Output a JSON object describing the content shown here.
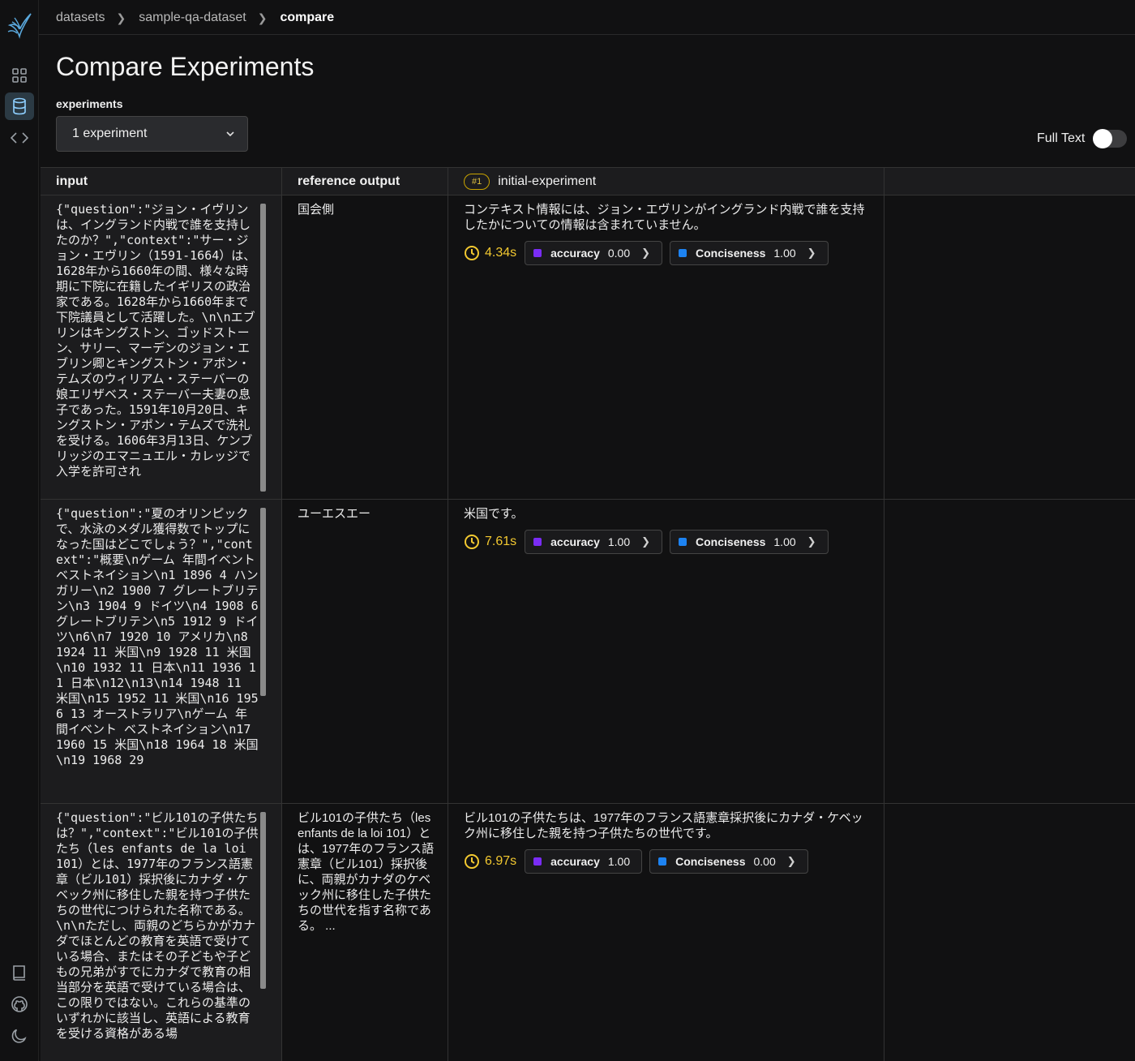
{
  "breadcrumb": {
    "items": [
      "datasets",
      "sample-qa-dataset"
    ],
    "current": "compare"
  },
  "page": {
    "title": "Compare Experiments"
  },
  "experiments": {
    "label": "experiments",
    "selected": "1 experiment"
  },
  "full_text": {
    "label": "Full Text",
    "enabled": false
  },
  "columns": {
    "input": "input",
    "reference": "reference output",
    "experiment_badge": "#1",
    "experiment_name": "initial-experiment"
  },
  "colors": {
    "accuracy": "#7a2cf5",
    "conciseness": "#1d83f2",
    "latency": "#f2c830"
  },
  "rows": [
    {
      "input": "{\"question\":\"ジョン・イヴリンは、イングランド内戦で誰を支持したのか？\",\"context\":\"サー・ジョン・エヴリン（1591-1664）は、1628年から1660年の間、様々な時期に下院に在籍したイギリスの政治家である。1628年から1660年まで下院議員として活躍した。\\n\\nエブリンはキングストン、ゴッドストーン、サリー、マーデンのジョン・エブリン卿とキングストン・アポン・テムズのウィリアム・ステーバーの娘エリザベス・ステーバー夫妻の息子であった。1591年10月20日、キングストン・アポン・テムズで洗礼を受ける。1606年3月13日、ケンブリッジのエマニュエル・カレッジで入学を許可され",
      "reference": "国会側",
      "output": "コンテキスト情報には、ジョン・エヴリンがイングランド内戦で誰を支持したかについての情報は含まれていません。",
      "latency": "4.34s",
      "accuracy_label": "accuracy",
      "accuracy": "0.00",
      "conciseness_label": "Conciseness",
      "conciseness": "1.00"
    },
    {
      "input": "{\"question\":\"夏のオリンピックで、水泳のメダル獲得数でトップになった国はどこでしょう？\",\"context\":\"概要\\nゲーム 年間イベント ベストネイション\\n1 1896 4 ハンガリー\\n2 1900 7 グレートブリテン\\n3 1904 9 ドイツ\\n4 1908 6 グレートブリテン\\n5 1912 9 ドイツ\\n6\\n7 1920 10 アメリカ\\n8 1924 11 米国\\n9 1928 11 米国\\n10 1932 11 日本\\n11 1936 11 日本\\n12\\n13\\n14 1948 11 米国\\n15 1952 11 米国\\n16 1956 13 オーストラリア\\nゲーム 年間イベント ベストネイション\\n17 1960 15 米国\\n18 1964 18 米国\\n19 1968 29",
      "reference": "ユーエスエー",
      "output": "米国です。",
      "latency": "7.61s",
      "accuracy_label": "accuracy",
      "accuracy": "1.00",
      "conciseness_label": "Conciseness",
      "conciseness": "1.00"
    },
    {
      "input": "{\"question\":\"ビル101の子供たちは？\",\"context\":\"ビル101の子供たち（les enfants de la loi 101）とは、1977年のフランス語憲章（ビル101）採択後にカナダ・ケベック州に移住した親を持つ子供たちの世代につけられた名称である。\\n\\nただし、両親のどちらかがカナダでほとんどの教育を英語で受けている場合、またはその子どもや子どもの兄弟がすでにカナダで教育の相当部分を英語で受けている場合は、この限りではない。これらの基準のいずれかに該当し、英語による教育を受ける資格がある場",
      "reference": "ビル101の子供たち（les enfants de la loi 101）とは、1977年のフランス語憲章（ビル101）採択後に、両親がカナダのケベック州に移住した子供たちの世代を指す名称である。 ...",
      "output": "ビル101の子供たちは、1977年のフランス語憲章採択後にカナダ・ケベック州に移住した親を持つ子供たちの世代です。",
      "latency": "6.97s",
      "accuracy_label": "accuracy",
      "accuracy": "1.00",
      "conciseness_label": "Conciseness",
      "conciseness": "0.00"
    }
  ]
}
